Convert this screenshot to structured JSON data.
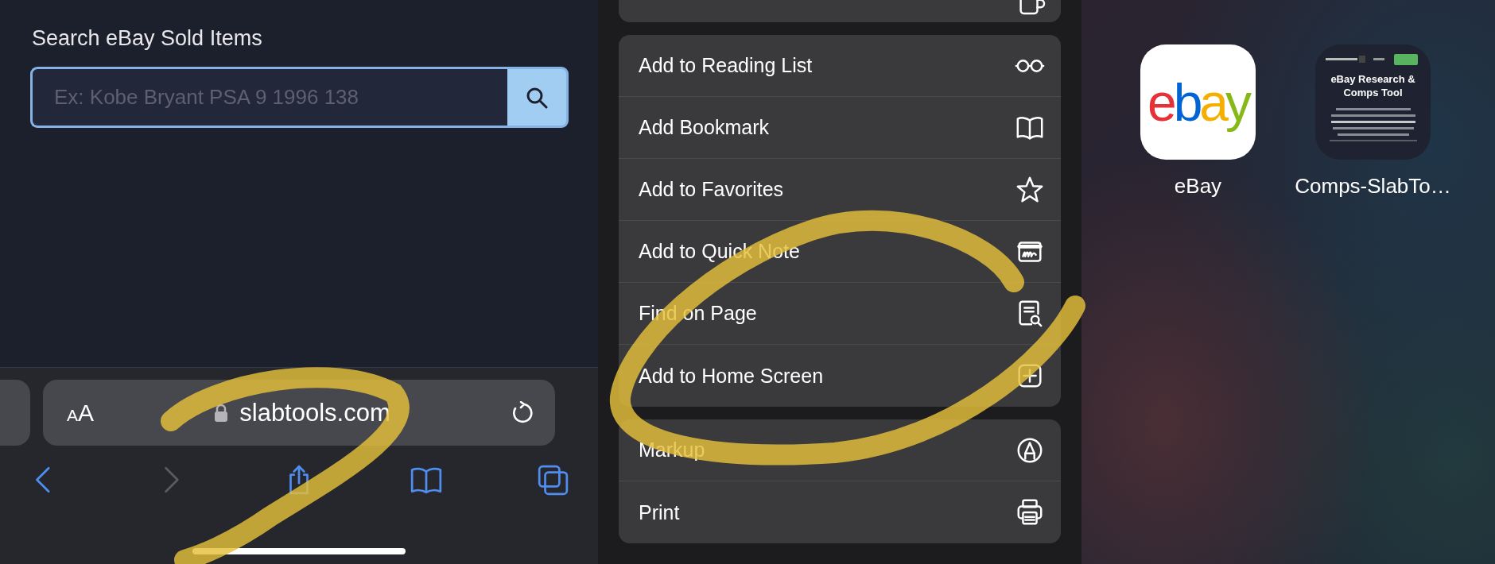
{
  "browser": {
    "heading": "Search eBay Sold Items",
    "search": {
      "placeholder": "Ex: Kobe Bryant PSA 9 1996 138"
    },
    "address_bar": {
      "text_size_label": "AA",
      "url": "slabtools.com"
    },
    "toolbar": [
      {
        "kind": "back",
        "disabled": false
      },
      {
        "kind": "forward",
        "disabled": true
      },
      {
        "kind": "share",
        "disabled": false
      },
      {
        "kind": "bookmarks",
        "disabled": false
      },
      {
        "kind": "tabs",
        "disabled": false
      }
    ]
  },
  "share_menu": {
    "groups": [
      {
        "items": [
          {
            "kind": "copy"
          }
        ]
      },
      {
        "items": [
          {
            "kind": "reading-list",
            "label": "Add to Reading List"
          },
          {
            "kind": "bookmark",
            "label": "Add Bookmark"
          },
          {
            "kind": "favorites",
            "label": "Add to Favorites"
          },
          {
            "kind": "quick-note",
            "label": "Add to Quick Note"
          },
          {
            "kind": "find",
            "label": "Find on Page"
          },
          {
            "kind": "home-screen",
            "label": "Add to Home Screen"
          }
        ]
      },
      {
        "items": [
          {
            "kind": "markup",
            "label": "Markup"
          },
          {
            "kind": "print",
            "label": "Print"
          }
        ]
      }
    ]
  },
  "home_screen": {
    "apps": [
      {
        "kind": "ebay",
        "logo_text": "ebay",
        "label": "eBay"
      },
      {
        "kind": "webclip",
        "thumbnail_title": "eBay Research & Comps Tool",
        "label": "Comps-SlabTo…"
      }
    ]
  }
}
